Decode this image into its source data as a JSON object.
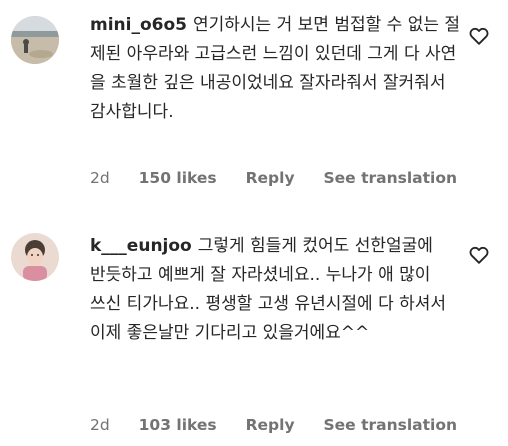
{
  "comments": [
    {
      "username": "mini_o6o5",
      "text": "연기하시는 거 보면 범접할 수 없는 절제된 아우라와 고급스런 느낌이 있던데 그게 다 사연을 초월한 깊은 내공이었네요 잘자라줘서 잘커줘서 감사합니다.",
      "time": "2d",
      "likes": "150 likes",
      "reply": "Reply",
      "translate": "See translation"
    },
    {
      "username": "k___eunjoo",
      "text": "그렇게 힘들게 컸어도 선한얼굴에 반듯하고 예쁘게 잘 자라셨네요.. 누나가 애 많이 쓰신 티가나요.. 평생할 고생 유년시절에 다 하셔서 이제 좋은날만 기다리고 있을거에요^^",
      "time": "2d",
      "likes": "103 likes",
      "reply": "Reply",
      "translate": "See translation"
    }
  ],
  "icons": {
    "avatar": "avatar-photo",
    "like": "heart-outline-icon"
  }
}
